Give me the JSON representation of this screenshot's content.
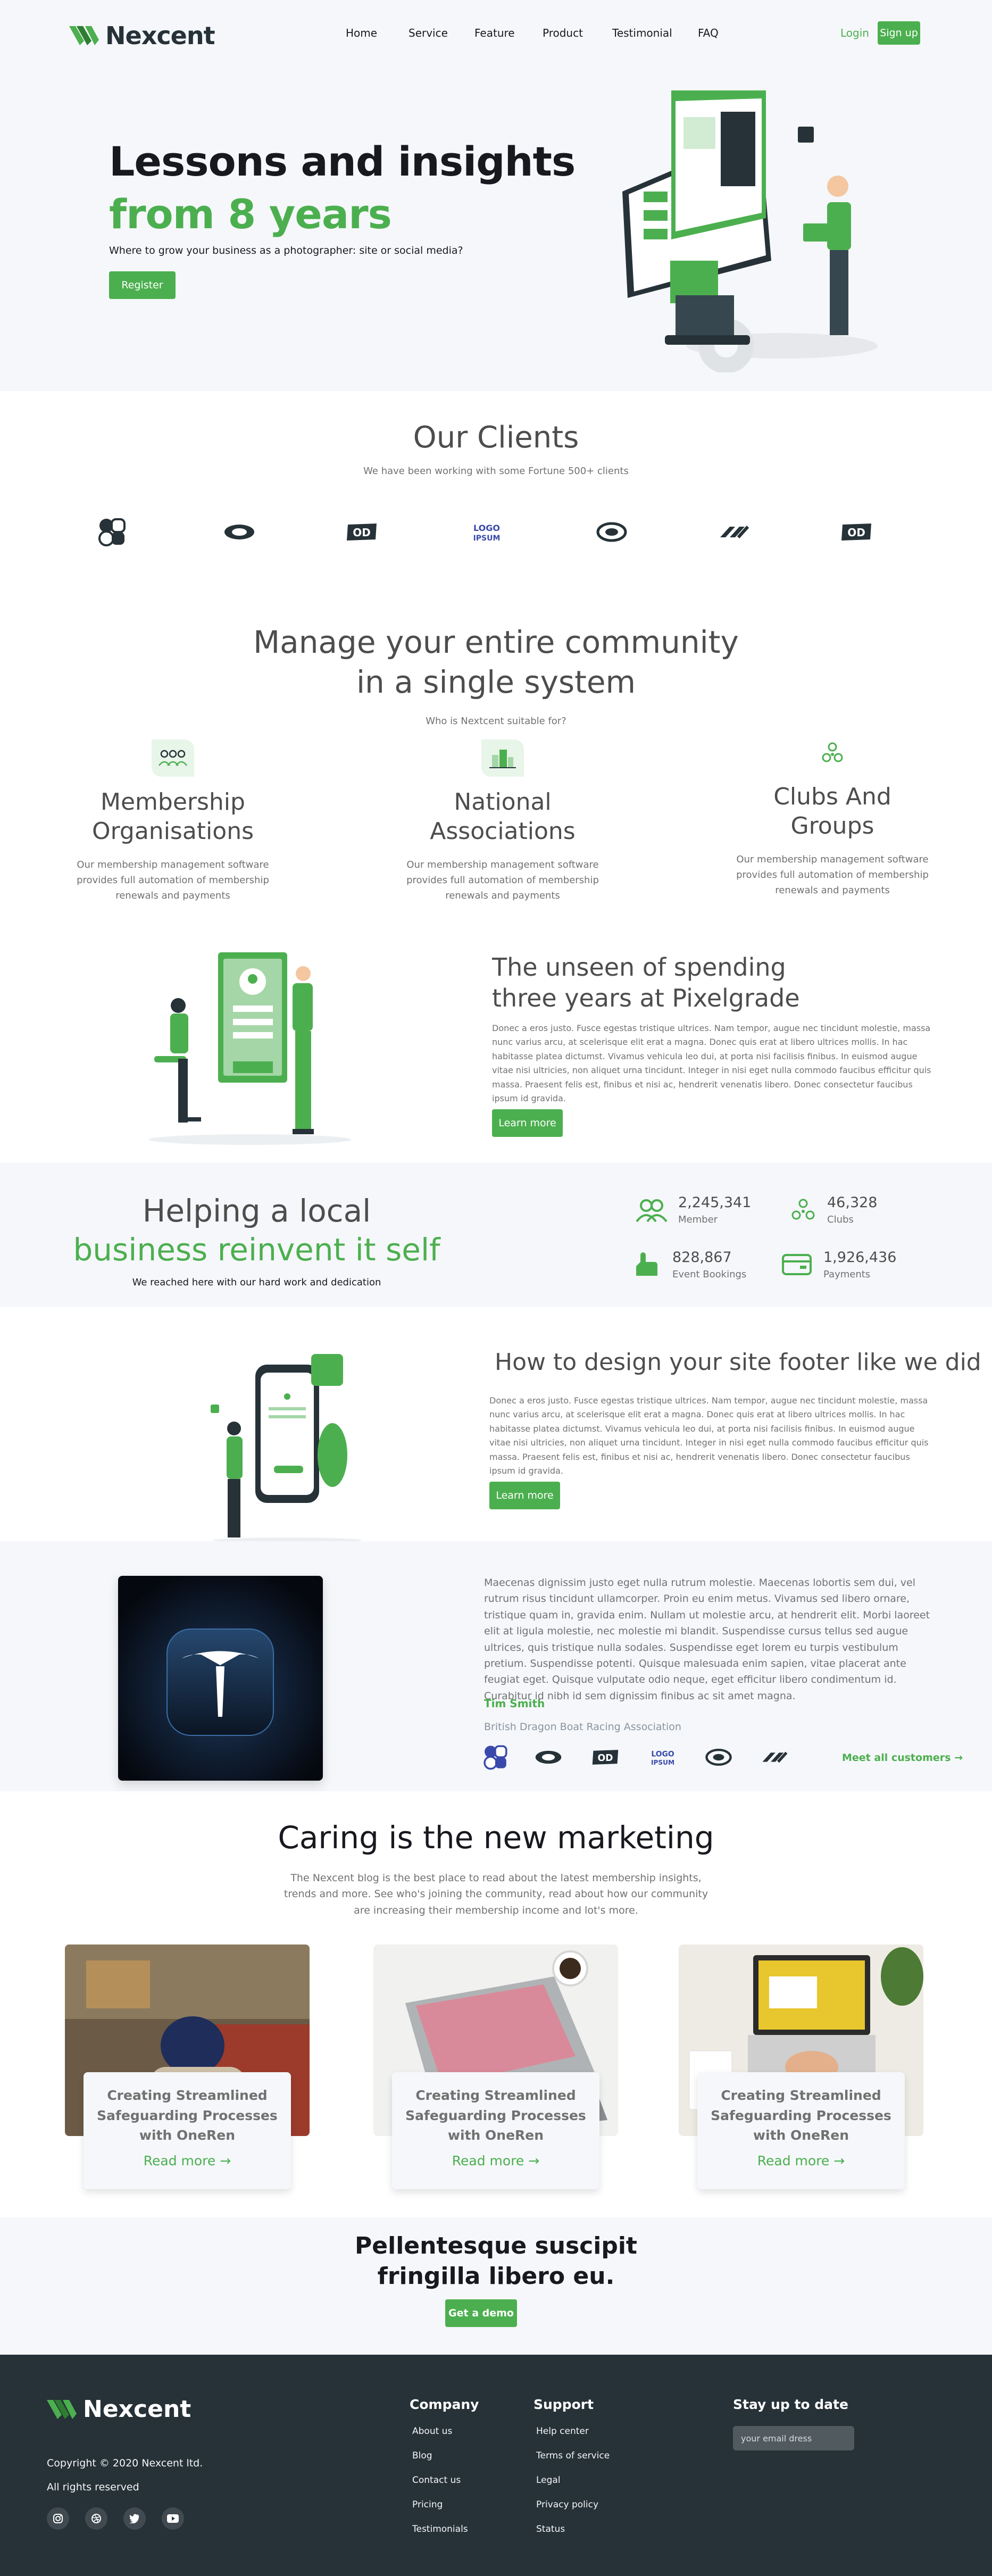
{
  "brand": {
    "name": "Nexcent",
    "color": "#4caf4f"
  },
  "nav": {
    "items": [
      "Home",
      "Service",
      "Feature",
      "Product",
      "Testimonial",
      "FAQ"
    ],
    "login": "Login",
    "signup": "Sign up"
  },
  "hero": {
    "title_line1": "Lessons and insights",
    "title_line2": "from 8 years",
    "subtitle": "Where to grow your business as a photographer: site or social media?",
    "cta": "Register"
  },
  "clients": {
    "title": "Our Clients",
    "subtitle": "We have been working with some Fortune 500+ clients"
  },
  "community": {
    "title_line1": "Manage your entire community",
    "title_line2": "in a single system",
    "subtitle": "Who is Nextcent suitable for?",
    "features": [
      {
        "title": "Membership Organisations",
        "desc": "Our membership management software provides full automation of membership renewals and payments"
      },
      {
        "title": "National Associations",
        "desc": "Our membership management software provides full automation of membership renewals and payments"
      },
      {
        "title": "Clubs And Groups",
        "desc": "Our membership management software provides full automation of membership renewals and payments"
      }
    ]
  },
  "unseen": {
    "title": "The unseen of spending three years at Pixelgrade",
    "body": "Donec a eros justo. Fusce egestas tristique ultrices. Nam tempor, augue nec tincidunt molestie, massa nunc varius arcu, at scelerisque elit erat a magna. Donec quis erat at libero ultrices mollis. In hac habitasse platea dictumst. Vivamus vehicula leo dui, at porta nisi facilisis finibus. In euismod augue vitae nisi ultricies, non aliquet urna tincidunt. Integer in nisi eget nulla commodo faucibus efficitur quis massa. Praesent felis est, finibus et nisi ac, hendrerit venenatis libero. Donec consectetur faucibus ipsum id gravida.",
    "cta": "Learn more"
  },
  "helping": {
    "title_line1": "Helping a local",
    "title_line2": "business reinvent it self",
    "subtitle": "We reached here with our hard work and dedication",
    "stats": [
      {
        "value": "2,245,341",
        "label": "Member",
        "icon": "members-icon"
      },
      {
        "value": "46,328",
        "label": "Clubs",
        "icon": "clubs-icon"
      },
      {
        "value": "828,867",
        "label": "Event Bookings",
        "icon": "click-icon"
      },
      {
        "value": "1,926,436",
        "label": "Payments",
        "icon": "card-icon"
      }
    ]
  },
  "design": {
    "title": "How to design your site footer like we did",
    "body": "Donec a eros justo. Fusce egestas tristique ultrices. Nam tempor, augue nec tincidunt molestie, massa nunc varius arcu, at scelerisque elit erat a magna. Donec quis erat at libero ultrices mollis. In hac habitasse platea dictumst. Vivamus vehicula leo dui, at porta nisi facilisis finibus. In euismod augue vitae nisi ultricies, non aliquet urna tincidunt. Integer in nisi eget nulla commodo faucibus efficitur quis massa. Praesent felis est, finibus et nisi ac, hendrerit venenatis libero. Donec consectetur faucibus ipsum id gravida.",
    "cta": "Learn more"
  },
  "testimonial": {
    "quote": "Maecenas dignissim justo eget nulla rutrum molestie. Maecenas lobortis sem dui, vel rutrum risus tincidunt ullamcorper. Proin eu enim metus. Vivamus sed libero ornare, tristique quam in, gravida enim. Nullam ut molestie arcu, at hendrerit elit. Morbi laoreet elit at ligula molestie, nec molestie mi blandit. Suspendisse cursus tellus sed augue ultrices, quis tristique nulla sodales. Suspendisse eget lorem eu turpis vestibulum pretium. Suspendisse potenti. Quisque malesuada enim sapien, vitae placerat ante feugiat eget. Quisque vulputate odio neque, eget efficitur libero condimentum id. Curabitur id nibh id sem dignissim finibus ac sit amet magna.",
    "name": "Tim Smith",
    "org": "British Dragon Boat Racing Association",
    "meet": "Meet all customers"
  },
  "blog": {
    "title": "Caring is the new marketing",
    "subtitle": "The Nexcent blog is the best place to read about the latest membership insights, trends and more. See who's joining the community, read about how our community are increasing their membership income and lot's more.",
    "cards": [
      {
        "title": "Creating Streamlined Safeguarding Processes with OneRen",
        "link": "Read more"
      },
      {
        "title": "Creating Streamlined Safeguarding Processes with OneRen",
        "link": "Read more"
      },
      {
        "title": "Creating Streamlined Safeguarding Processes with OneRen",
        "link": "Read more"
      }
    ]
  },
  "cta": {
    "title_line1": "Pellentesque suscipit",
    "title_line2": "fringilla libero eu.",
    "button": "Get a demo"
  },
  "footer": {
    "copyright": "Copyright © 2020 Nexcent ltd.",
    "rights": "All rights reserved",
    "company": {
      "title": "Company",
      "items": [
        "About us",
        "Blog",
        "Contact us",
        "Pricing",
        "Testimonials"
      ]
    },
    "support": {
      "title": "Support",
      "items": [
        "Help center",
        "Terms of service",
        "Legal",
        "Privacy policy",
        "Status"
      ]
    },
    "newsletter": {
      "title": "Stay up to date",
      "placeholder": "your email dress"
    },
    "social": [
      "instagram-icon",
      "dribbble-icon",
      "twitter-icon",
      "youtube-icon"
    ]
  }
}
